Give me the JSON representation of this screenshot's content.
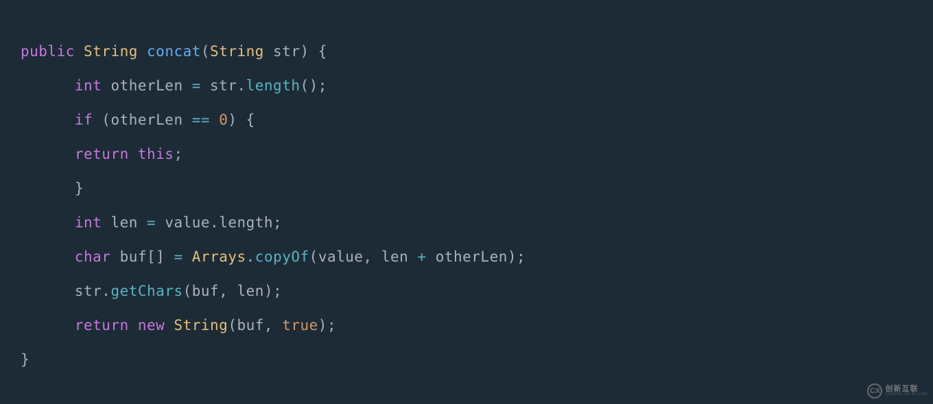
{
  "code": {
    "line1": {
      "public": "public",
      "type": "String",
      "method": "concat",
      "paren_open": "(",
      "param_type": "String",
      "param_name": " str",
      "paren_close": ")",
      "brace": " {"
    },
    "line2": {
      "type": "int",
      "ident": " otherLen ",
      "eq": "=",
      "expr1": " str",
      "dot": ".",
      "call": "length",
      "parens": "()",
      "semi": ";"
    },
    "line3": {
      "if": "if",
      "paren_open": " (",
      "ident": "otherLen ",
      "op": "==",
      "space": " ",
      "num": "0",
      "paren_close": ")",
      "brace": " {"
    },
    "line4": {
      "return": "return",
      "space": " ",
      "this": "this",
      "semi": ";"
    },
    "line5": {
      "brace": "}"
    },
    "line6": {
      "type": "int",
      "ident": " len ",
      "eq": "=",
      "expr": " value",
      "dot": ".",
      "prop": "length",
      "semi": ";"
    },
    "line7": {
      "type": "char",
      "ident": " buf",
      "brackets": "[]",
      "sp": " ",
      "eq": "=",
      "sp2": " ",
      "cls": "Arrays",
      "dot": ".",
      "call": "copyOf",
      "paren_open": "(",
      "arg1": "value",
      "comma": ", ",
      "arg2": "len ",
      "plus": "+",
      "arg3": " otherLen",
      "paren_close": ")",
      "semi": ";"
    },
    "line8": {
      "ident": "str",
      "dot": ".",
      "call": "getChars",
      "paren_open": "(",
      "arg1": "buf",
      "comma": ", ",
      "arg2": "len",
      "paren_close": ")",
      "semi": ";"
    },
    "line9": {
      "return": "return",
      "space": " ",
      "new": "new",
      "space2": " ",
      "type": "String",
      "paren_open": "(",
      "arg1": "buf",
      "comma": ", ",
      "bool": "true",
      "paren_close": ")",
      "semi": ";"
    },
    "line10": {
      "brace": "}"
    }
  },
  "watermark": {
    "logo": "CX",
    "cn": "创新互联",
    "py": "CHUANG XIN HU LIAN"
  }
}
